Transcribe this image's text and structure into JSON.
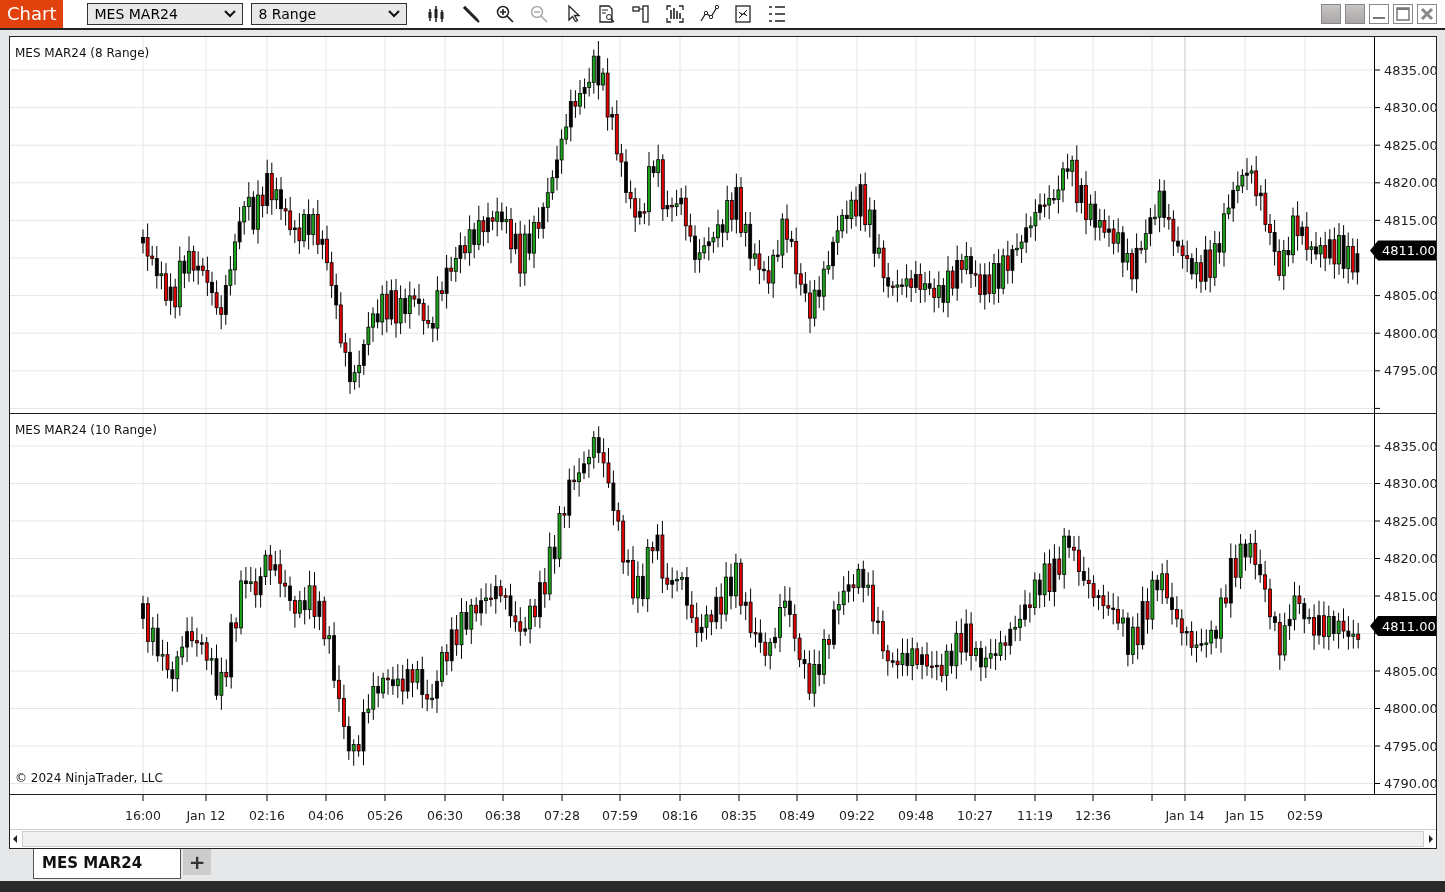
{
  "toolbar": {
    "title": "Chart",
    "instrument": "MES MAR24",
    "bar_type": "8 Range"
  },
  "panes": [
    {
      "title": "MES MAR24 (8 Range)",
      "y_labels": [
        "4835.00",
        "4830.00",
        "4825.00",
        "4820.00",
        "4815.00",
        "4805.00",
        "4800.00",
        "4795.00"
      ],
      "price_tag": "4811.00"
    },
    {
      "title": "MES MAR24 (10 Range)",
      "y_labels": [
        "4835.00",
        "4830.00",
        "4825.00",
        "4820.00",
        "4815.00",
        "4805.00",
        "4800.00",
        "4795.00",
        "4790.00"
      ],
      "price_tag": "4811.00",
      "footer": "© 2024 NinjaTrader, LLC"
    }
  ],
  "x_axis": {
    "labels": [
      "16:00",
      "Jan 12",
      "02:16",
      "04:06",
      "05:26",
      "06:30",
      "06:38",
      "07:28",
      "07:59",
      "08:16",
      "08:35",
      "08:49",
      "09:22",
      "09:48",
      "10:27",
      "11:19",
      "12:36",
      "Jan 14",
      "Jan 15",
      "02:59"
    ]
  },
  "tabs": [
    {
      "label": "MES MAR24",
      "selected": true
    }
  ],
  "add_tab": "+"
}
